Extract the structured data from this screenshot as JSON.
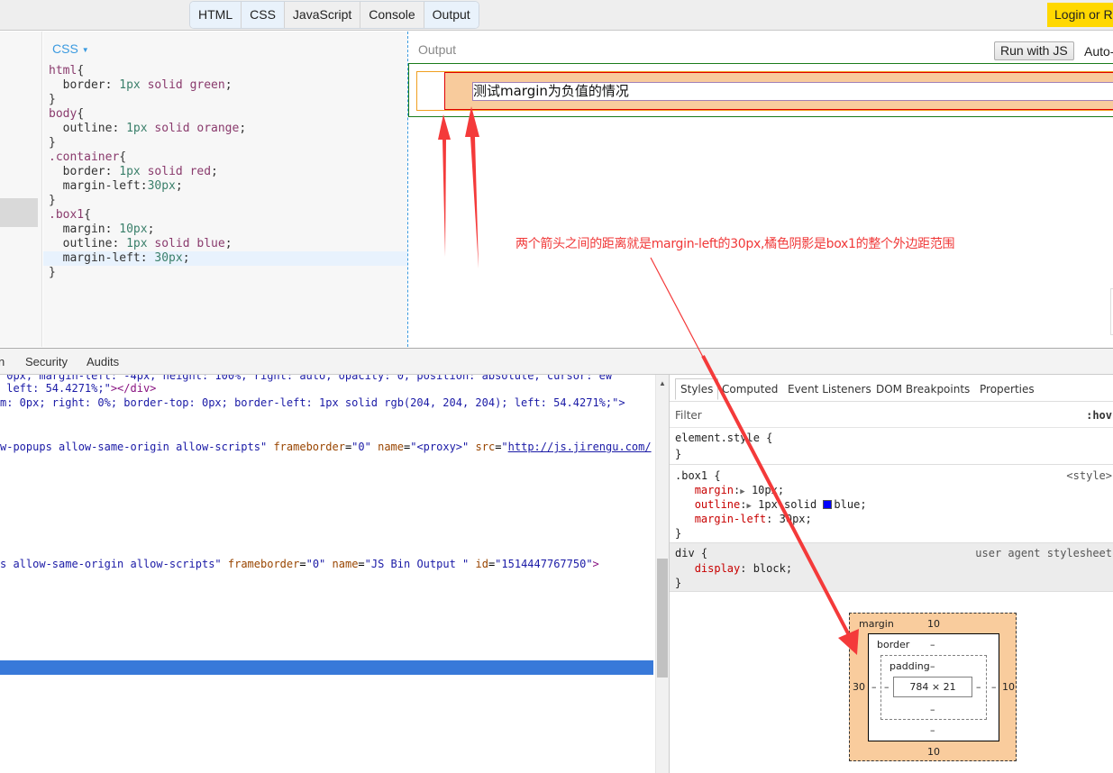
{
  "topbar": {
    "tabs": [
      {
        "label": "HTML",
        "active": true
      },
      {
        "label": "CSS",
        "active": true
      },
      {
        "label": "JavaScript",
        "active": false
      },
      {
        "label": "Console",
        "active": false
      },
      {
        "label": "Output",
        "active": true
      }
    ],
    "login_label": "Login or Register"
  },
  "editor": {
    "language_label": "CSS",
    "code_lines": [
      "html{",
      "  border: 1px solid green;",
      "}",
      "body{",
      "  outline: 1px solid orange;",
      "}",
      ".container{",
      "  border: 1px solid red;",
      "  margin-left:30px;",
      "}",
      ".box1{",
      "  margin: 10px;",
      "  outline: 1px solid blue;",
      "  margin-left: 30px;",
      "}"
    ],
    "highlighted_line": 13
  },
  "output": {
    "label": "Output",
    "run_button": "Run with JS",
    "auto_label": "Auto-run JS",
    "demo_text": "测试margin为负值的情况"
  },
  "annotation": {
    "text": "两个箭头之间的距离就是margin-left的30px,橘色阴影是box1的整个外边距范围",
    "color": "#f03838"
  },
  "devtools": {
    "tabs": [
      "n",
      "Security",
      "Audits"
    ],
    "elements_lines": [
      {
        "text": " 0px; margin-left: -4px; height: 100%; right: auto; opacity: 0; position: absolute; cursor: ew"
      },
      {
        "text": " left: 54.4271%;\"></div>"
      },
      {
        "text": "m: 0px; right: 0%; border-top: 0px; border-left: 1px solid rgb(204, 204, 204); left: 54.4271%;\">"
      },
      {
        "text": "w-popups allow-same-origin allow-scripts\" frameborder=\"0\" name=\"<proxy>\" src=\"http://js.jirengu.com/"
      },
      {
        "text": "s allow-same-origin allow-scripts\" frameborder=\"0\" name=\"JS Bin Output \" id=\"1514447767750\">"
      }
    ],
    "styles": {
      "tabs": [
        "Styles",
        "Computed",
        "Event Listeners",
        "DOM Breakpoints",
        "Properties"
      ],
      "active_tab": "Styles",
      "filter_placeholder": "Filter",
      "hov_label": ":hov",
      "element_style": "element.style {",
      "rule1_selector": ".box1 {",
      "rule1_source": "<style>",
      "rule1_props": [
        {
          "name": "margin",
          "value": "10px;",
          "expandable": true
        },
        {
          "name": "outline",
          "value": "1px solid",
          "color_swatch": "#0000ff",
          "value2": "blue;",
          "expandable": true
        },
        {
          "name": "margin-left",
          "value": "30px;",
          "expandable": false
        }
      ],
      "rule2_selector": "div {",
      "rule2_source": "user agent stylesheet",
      "rule2_props": [
        {
          "name": "display",
          "value": "block;"
        }
      ],
      "close_brace": "}"
    },
    "box_model": {
      "margin_label": "margin",
      "margin_top": "10",
      "margin_right": "10",
      "margin_bottom": "10",
      "margin_left": "30",
      "border_label": "border",
      "border_top": "–",
      "border_right": "–",
      "border_bottom": "–",
      "border_left": "–",
      "padding_label": "padding",
      "padding_top": "–",
      "padding_right": "–",
      "padding_bottom": "–",
      "padding_left": "–",
      "content": "784 × 21"
    }
  }
}
